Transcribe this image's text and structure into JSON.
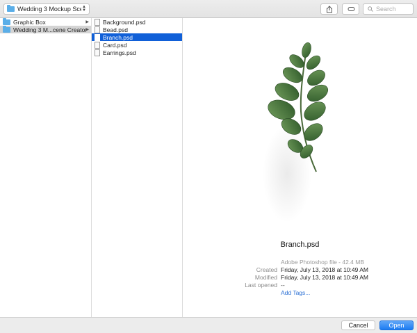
{
  "toolbar": {
    "location_label": "Wedding 3 Mockup Sce...",
    "search_placeholder": "Search"
  },
  "sidebar_column": {
    "items": [
      {
        "label": "Graphic Box",
        "selected": false
      },
      {
        "label": "Wedding 3 M...cene Creator",
        "selected": true
      }
    ]
  },
  "files_column": {
    "items": [
      {
        "label": "Background.psd",
        "selected": false
      },
      {
        "label": "Bead.psd",
        "selected": false
      },
      {
        "label": "Branch.psd",
        "selected": true
      },
      {
        "label": "Card.psd",
        "selected": false
      },
      {
        "label": "Earrings.psd",
        "selected": false
      }
    ]
  },
  "preview": {
    "file_name": "Branch.psd",
    "kind": "Adobe Photoshop file - 42.4 MB",
    "created_label": "Created",
    "created_value": "Friday, July 13, 2018 at 10:49 AM",
    "modified_label": "Modified",
    "modified_value": "Friday, July 13, 2018 at 10:49 AM",
    "last_opened_label": "Last opened",
    "last_opened_value": "--",
    "add_tags": "Add Tags..."
  },
  "footer": {
    "cancel_label": "Cancel",
    "open_label": "Open"
  },
  "colors": {
    "selection": "#1160d8",
    "accent": "#1d7cf2",
    "folder": "#5aaee8"
  }
}
